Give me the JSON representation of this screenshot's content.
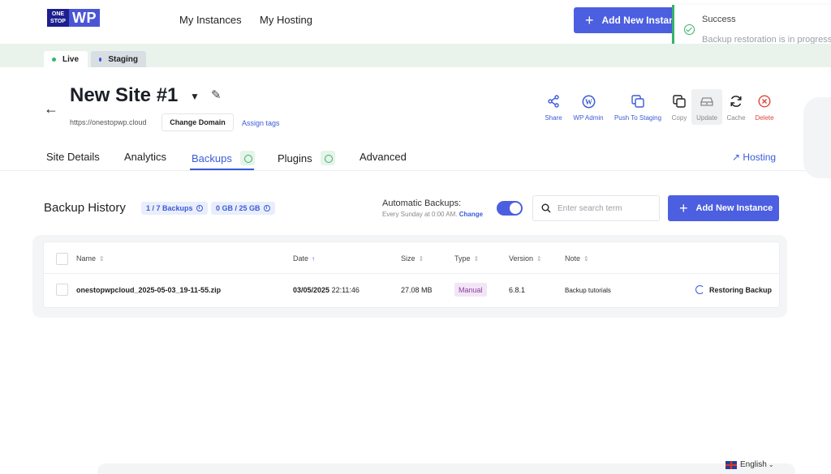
{
  "header": {
    "logo_small": "ONE STOP",
    "logo_big": "WP",
    "nav": [
      "My Instances",
      "My Hosting"
    ],
    "add_instance": "Add New Instance"
  },
  "toast": {
    "title": "Success",
    "message": "Backup restoration is in progress"
  },
  "environments": [
    {
      "label": "Live",
      "color": "#37b26a"
    },
    {
      "label": "Staging",
      "color": "#3a5bd9"
    }
  ],
  "site": {
    "title": "New Site #1",
    "url": "https://onestopwp.cloud",
    "change_domain": "Change Domain",
    "assign_tags": "Assign tags"
  },
  "actions": [
    {
      "label": "Share",
      "icon": "share-icon"
    },
    {
      "label": "WP Admin",
      "icon": "wordpress-icon"
    },
    {
      "label": "Push To Staging",
      "icon": "push-icon"
    },
    {
      "label": "Copy",
      "icon": "copy-icon"
    },
    {
      "label": "Update",
      "icon": "update-icon"
    },
    {
      "label": "Cache",
      "icon": "cache-icon"
    },
    {
      "label": "Delete",
      "icon": "delete-icon"
    }
  ],
  "tabs": [
    "Site Details",
    "Analytics",
    "Backups",
    "Plugins",
    "Advanced"
  ],
  "active_tab": "Backups",
  "hosting_link": "Hosting",
  "backups": {
    "title": "Backup History",
    "count_pill": "1 / 7 Backups",
    "storage_pill": "0 GB / 25 GB",
    "auto_label": "Automatic Backups:",
    "auto_schedule": "Every Sunday at 0:00 AM.",
    "auto_change": "Change",
    "auto_enabled": true,
    "search_placeholder": "Enter search term",
    "add_button": "Add New Instance",
    "columns": [
      "Name",
      "Date",
      "Size",
      "Type",
      "Version",
      "Note"
    ],
    "rows": [
      {
        "name": "onestopwpcloud_2025-05-03_19-11-55.zip",
        "date": "03/05/2025",
        "time": "22:11:46",
        "size": "27.08 MB",
        "type": "Manual",
        "version": "6.8.1",
        "note": "Backup tutorials",
        "status": "Restoring Backup"
      }
    ]
  },
  "footer": {
    "language": "English"
  }
}
